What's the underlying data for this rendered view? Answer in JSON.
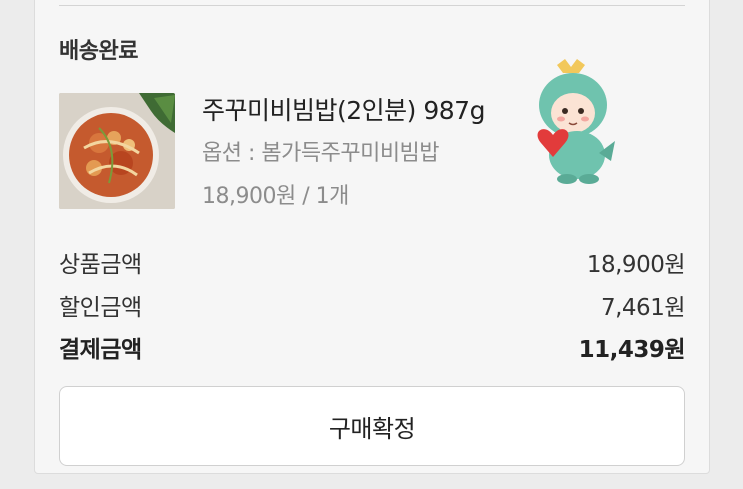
{
  "order": {
    "status": "배송완료",
    "product": {
      "name": "주꾸미비빔밥(2인분) 987g",
      "option": "옵션 : 봄가득주꾸미비빔밥",
      "price_qty": "18,900원 / 1개"
    },
    "summary": {
      "product_amount_label": "상품금액",
      "product_amount_value": "18,900원",
      "discount_label": "할인금액",
      "discount_value": "7,461원",
      "payment_label": "결제금액",
      "payment_value": "11,439원"
    },
    "confirm_button_label": "구매확정"
  },
  "icons": {
    "product_image": "bibimbap-food-photo",
    "sticker": "dragon-character-with-heart-sticker"
  },
  "colors": {
    "background": "#ececec",
    "card": "#f6f6f6",
    "muted_text": "#8c8c8c",
    "sticker_mint": "#6fc3ae",
    "sticker_heart": "#e23b3b"
  }
}
